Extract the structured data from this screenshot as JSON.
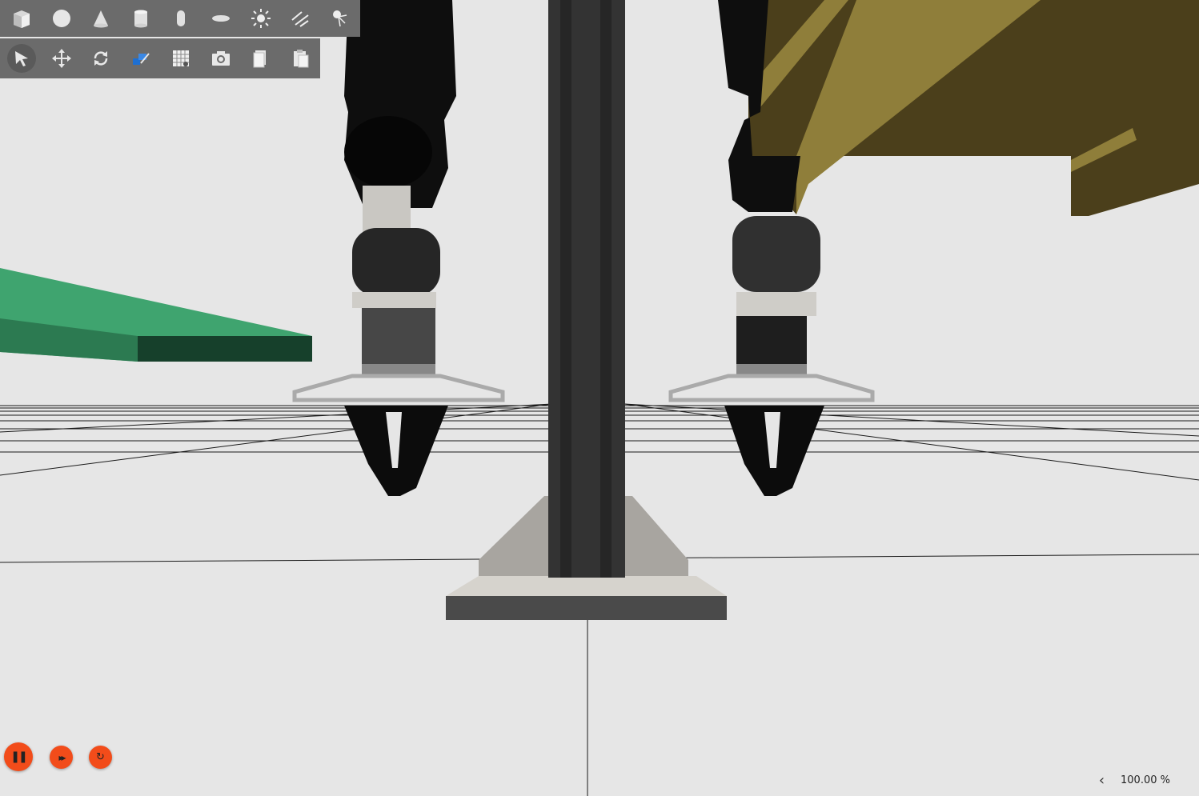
{
  "toolbar_top": {
    "buttons": [
      {
        "name": "box-icon",
        "label": "Box"
      },
      {
        "name": "sphere-icon",
        "label": "Sphere"
      },
      {
        "name": "cone-icon",
        "label": "Cone"
      },
      {
        "name": "cylinder-icon",
        "label": "Cylinder"
      },
      {
        "name": "capsule-icon",
        "label": "Capsule"
      },
      {
        "name": "ellipsoid-icon",
        "label": "Ellipsoid"
      },
      {
        "name": "point-light-icon",
        "label": "Point light"
      },
      {
        "name": "directional-light-icon",
        "label": "Directional light"
      },
      {
        "name": "spot-light-icon",
        "label": "Spot light"
      }
    ]
  },
  "toolbar_bottom": {
    "buttons": [
      {
        "name": "select-mode-icon",
        "label": "Select",
        "active": true
      },
      {
        "name": "translate-mode-icon",
        "label": "Translate"
      },
      {
        "name": "rotate-mode-icon",
        "label": "Rotate"
      },
      {
        "name": "scale-mode-icon",
        "label": "Scale"
      },
      {
        "name": "align-grid-icon",
        "label": "Snap to grid"
      },
      {
        "name": "screenshot-camera-icon",
        "label": "Screenshot"
      },
      {
        "name": "copy-icon",
        "label": "Copy"
      },
      {
        "name": "paste-icon",
        "label": "Paste"
      }
    ]
  },
  "controls": {
    "pause_glyph": "❚❚",
    "step_glyph": "▸▸",
    "reset_glyph": "↻",
    "accent": "#f24c1a"
  },
  "footer": {
    "collapse_glyph": "‹",
    "real_time_factor": "100.00 %"
  },
  "scene_colors": {
    "background": "#e6e6e6",
    "green_table": "#3fa46f",
    "yellow_box": "#8f7e3a",
    "robot": "#0e0e0e",
    "column": "#333333"
  }
}
